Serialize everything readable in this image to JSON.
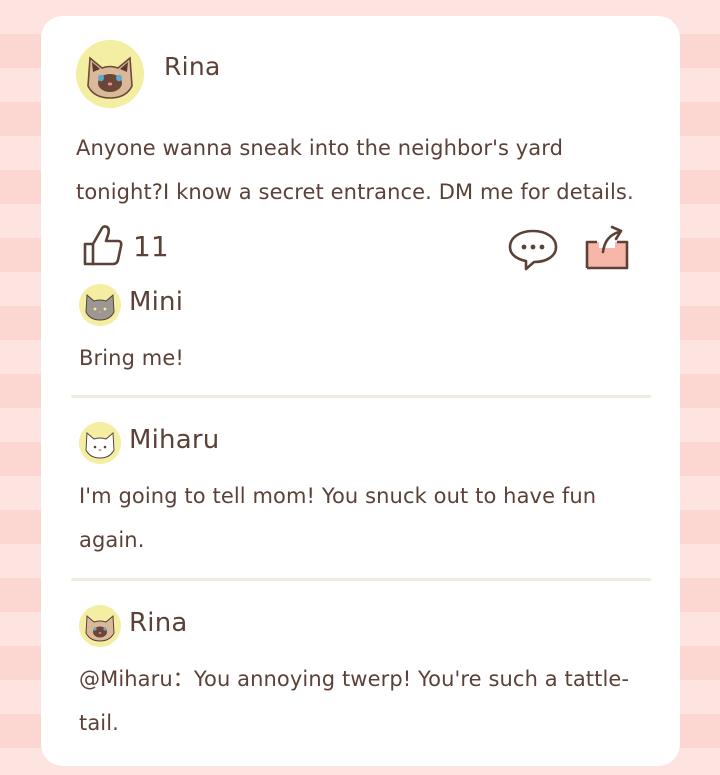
{
  "post": {
    "author": "Rina",
    "text": "Anyone wanna sneak into the neighbor's yard tonight?I know a secret entrance. DM me for details.",
    "likes": "11"
  },
  "comments": [
    {
      "author": "Mini",
      "text": "Bring me!"
    },
    {
      "author": "Miharu",
      "text": "I'm going to tell mom! You snuck out to have fun again."
    },
    {
      "author": "Rina",
      "text": "@Miharu：You annoying twerp! You're such a tattle-tail."
    }
  ],
  "icons": {
    "like": "thumbs-up-icon",
    "comment": "speech-bubble-icon",
    "share": "share-icon"
  },
  "colors": {
    "background_stripe_a": "#fde4e0",
    "background_stripe_b": "#fcd6d1",
    "text": "#5b4138",
    "avatar_bg": "#f4eea3",
    "share_fill": "#f6b7a8"
  }
}
